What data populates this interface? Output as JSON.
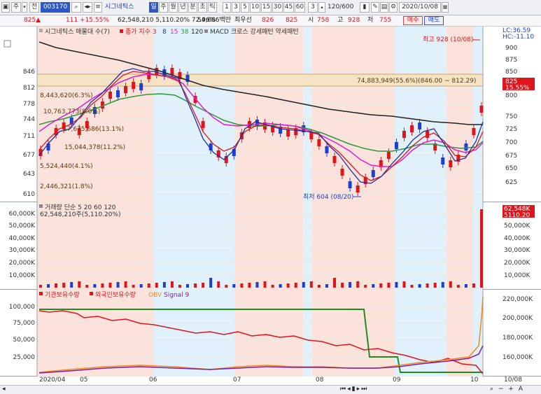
{
  "toolbar": {
    "code": "003170",
    "name": "시그네틱스",
    "period_tabs": [
      "일",
      "주",
      "월",
      "년",
      "분",
      "초",
      "틱"
    ],
    "active_tab": "일",
    "minute_opts": [
      "1",
      "3",
      "5",
      "10",
      "15",
      "30",
      "45",
      "60"
    ],
    "count_val": "3",
    "count_page": "120/600",
    "date": "2020/10/08",
    "buy_label": "매수",
    "sell_label": "매도",
    "left_tabs": [
      "주",
      "전"
    ]
  },
  "quote": {
    "price": "825▲",
    "change": "111 +15.55%",
    "volume_info": "62,548,210 5,110.20% 72.96%",
    "amount": "54,686백만",
    "sell_lbl": "최우선",
    "ask": "826",
    "bid": "825",
    "open_lbl": "시",
    "open": "758",
    "high_lbl": "고",
    "high": "928",
    "low_lbl": "저",
    "low": "755"
  },
  "price_pane": {
    "legend": "시그네틱스 매물대 수(7)",
    "legend2": "종가 지수 3",
    "legend_ma": [
      "8",
      "15",
      "38",
      "120"
    ],
    "legend3": "MACD 크로스 강세패턴  약세패턴",
    "lc": "LC:36.59",
    "hc": "HC:-11.10",
    "max_label": "최고 928 (10/08)",
    "min_label": "최저 604 (08/20)",
    "band_label": "74,883,949(55.6%)(846.00 ~ 812.29)",
    "vp_labels": [
      "8,443,620(6.3%)",
      "10,763,773(8.0%)",
      "17,675,686(13.1%)",
      "15,044,378(11.2%)",
      "5,524,440(4.1%)",
      "2,446,321(1.8%)"
    ],
    "left_ticks": [
      "846",
      "812",
      "778",
      "744",
      "711",
      "677",
      "643",
      "610"
    ],
    "right_ticks": [
      "900",
      "875",
      "850",
      "825",
      "800",
      "775",
      "750",
      "725",
      "700",
      "675",
      "650",
      "625"
    ],
    "last_price": "825",
    "last_pct": "15.55%"
  },
  "volume_pane": {
    "legend": "거래량  단순 5  20  60  120",
    "sub": "62,548,210주(5,110.20%)",
    "left_ticks": [
      "60,000K",
      "50,000K",
      "40,000K",
      "30,000K",
      "20,000K",
      "10,000K"
    ],
    "right_ticks": [
      "50,000K",
      "40,000K",
      "30,000K",
      "20,000K",
      "10,000K"
    ],
    "last": "62,548K",
    "last_pct": "5110.20"
  },
  "flow_pane": {
    "legend": [
      "기관보유수량",
      "외국인보유수량",
      "OBV",
      "Signal 9"
    ],
    "left_ticks": [
      "100,000",
      "75,000",
      "50,000",
      "25,000"
    ],
    "right_ticks": [
      "220,000K",
      "200,000K",
      "180,000K",
      "160,000K"
    ]
  },
  "xaxis": [
    "2020/04",
    "05",
    "06",
    "07",
    "08",
    "09",
    "10",
    "10/08"
  ],
  "colors": {
    "up": "#e0151b",
    "down": "#1b3fd1",
    "ma8": "#1b2fa8",
    "ma15": "#e0151b",
    "ma38": "#e21bd0",
    "ma120": "#2b9a3a",
    "long": "#222222"
  }
}
